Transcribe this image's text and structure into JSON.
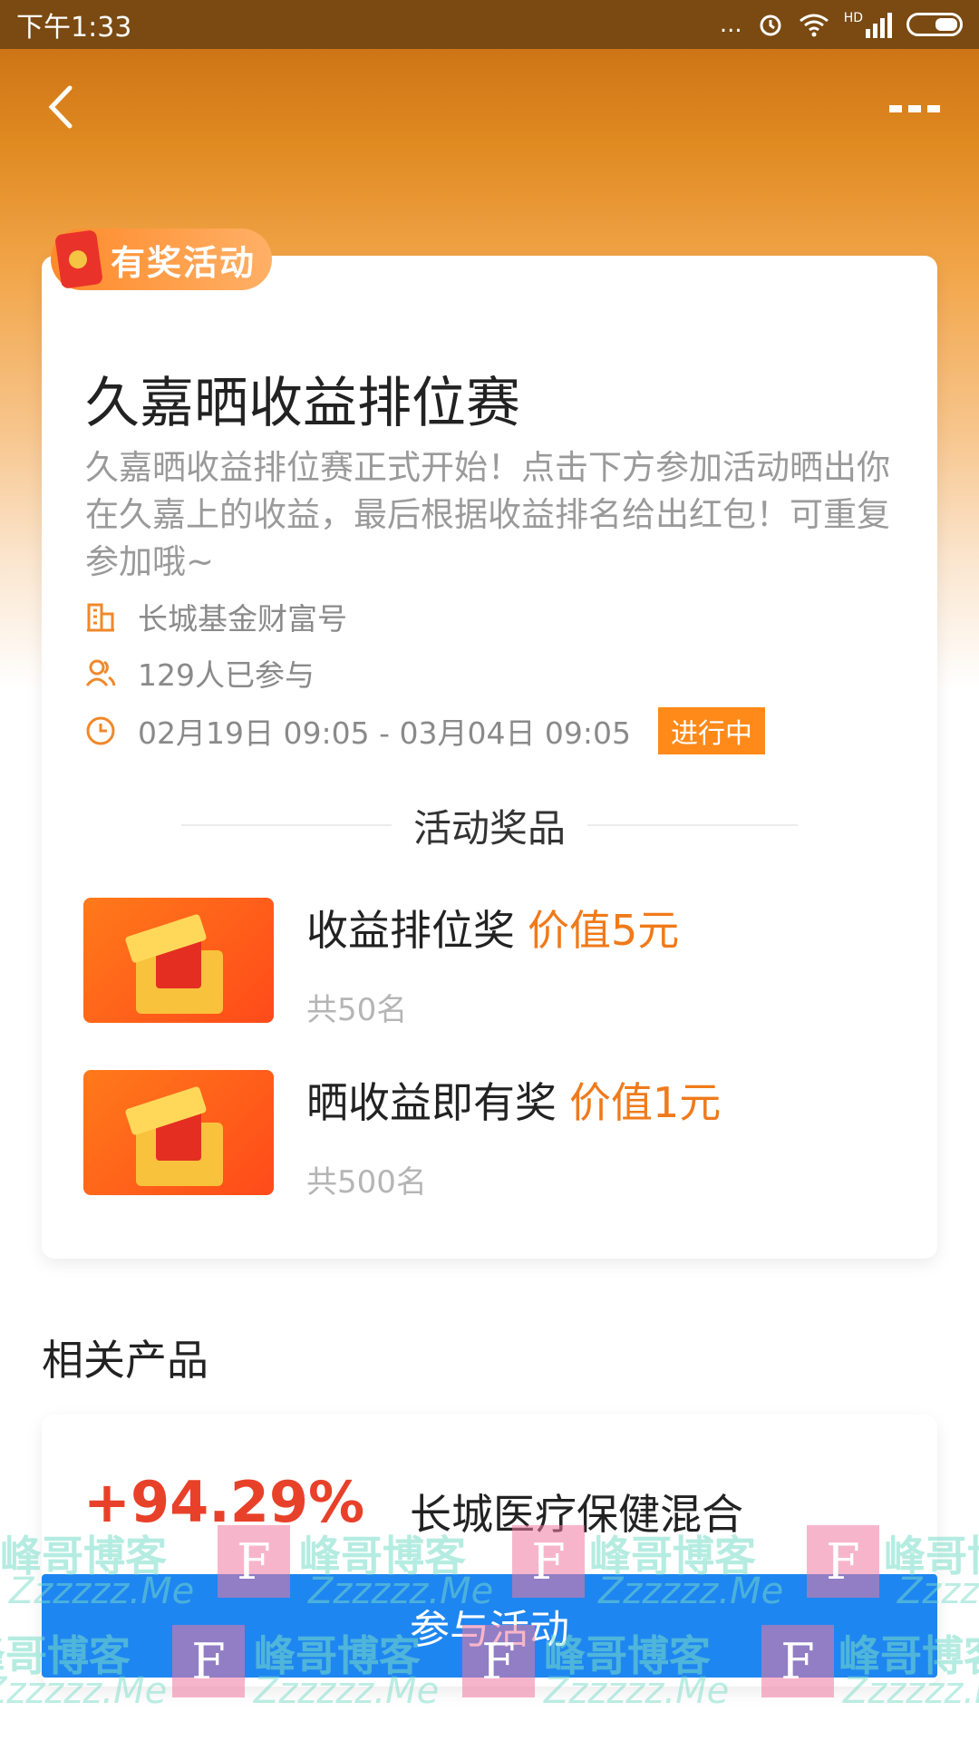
{
  "status_bar": {
    "time": "下午1:33",
    "dots": "...",
    "network": "HD"
  },
  "header": {
    "back_icon": "chevron-left-icon",
    "more_icon": "more-dots-icon"
  },
  "activity": {
    "tag": "有奖活动",
    "title": "久嘉晒收益排位赛",
    "description": "久嘉晒收益排位赛正式开始！点击下方参加活动晒出你在久嘉上的收益，最后根据收益排名给出红包！可重复参加哦~",
    "organizer": "长城基金财富号",
    "participants": "129人已参与",
    "period": "02月19日 09:05 - 03月04日 09:05",
    "status": "进行中"
  },
  "prizes": {
    "section_title": "活动奖品",
    "items": [
      {
        "name": "收益排位奖",
        "value": "价值5元",
        "count": "共50名"
      },
      {
        "name": "晒收益即有奖",
        "value": "价值1元",
        "count": "共500名"
      }
    ]
  },
  "related": {
    "title": "相关产品",
    "product_return": "+94.29%",
    "product_name": "长城医疗保健混合"
  },
  "cta": {
    "join_label": "参与活动"
  },
  "watermark": {
    "text1": "峰哥博客",
    "text2": "Zzzzzz.Me",
    "logo": "F"
  },
  "colors": {
    "accent_orange": "#ff8a1a",
    "return_red": "#e8412a",
    "button_blue": "#1e86f0"
  }
}
